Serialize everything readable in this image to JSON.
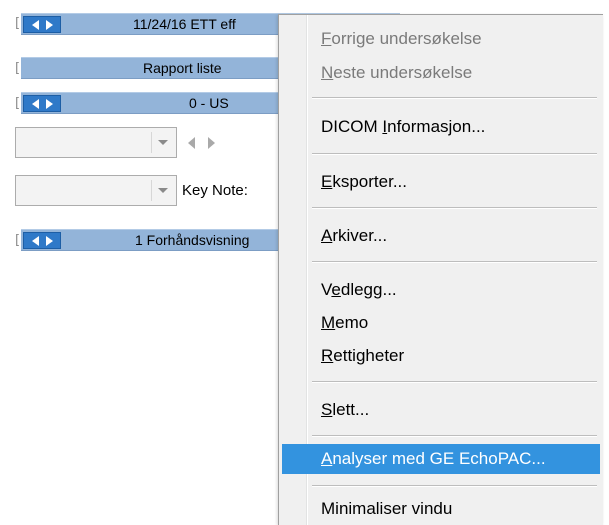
{
  "left_panel": {
    "rows": [
      {
        "label": "11/24/16 ETT eff",
        "has_arrows": true
      },
      {
        "label": "Rapport liste",
        "has_arrows": false
      },
      {
        "label": "0 - US",
        "has_arrows": true
      },
      {
        "label": "1 Forhåndsvisning",
        "has_arrows": true
      }
    ],
    "key_note_label": "Key Note:",
    "icons": {
      "prev": "arrow-left-icon",
      "next": "arrow-right-icon",
      "dropdown": "chevron-down-icon"
    }
  },
  "menu": {
    "items": [
      {
        "pre": "",
        "u": "F",
        "post": "orrige undersøkelse",
        "disabled": true
      },
      {
        "pre": "",
        "u": "N",
        "post": "este undersøkelse",
        "disabled": true
      },
      {
        "pre": "DICOM ",
        "u": "I",
        "post": "nformasjon...",
        "disabled": false
      },
      {
        "pre": "",
        "u": "E",
        "post": "ksporter...",
        "disabled": false
      },
      {
        "pre": "",
        "u": "A",
        "post": "rkiver...",
        "disabled": false
      },
      {
        "pre": "V",
        "u": "e",
        "post": "dlegg...",
        "disabled": false
      },
      {
        "pre": "",
        "u": "M",
        "post": "emo",
        "disabled": false
      },
      {
        "pre": "",
        "u": "R",
        "post": "ettigheter",
        "disabled": false
      },
      {
        "pre": "",
        "u": "S",
        "post": "lett...",
        "disabled": false
      },
      {
        "pre": "",
        "u": "A",
        "post": "nalyser med GE EchoPAC...",
        "disabled": false,
        "highlighted": true
      },
      {
        "pre": "Minimaliser vindu",
        "u": "",
        "post": "",
        "disabled": false
      }
    ]
  },
  "colors": {
    "header_bg": "#93b4d9",
    "arrow_button": "#2f79c8",
    "highlight": "#3393df",
    "menu_bg": "#f0f0f0"
  }
}
